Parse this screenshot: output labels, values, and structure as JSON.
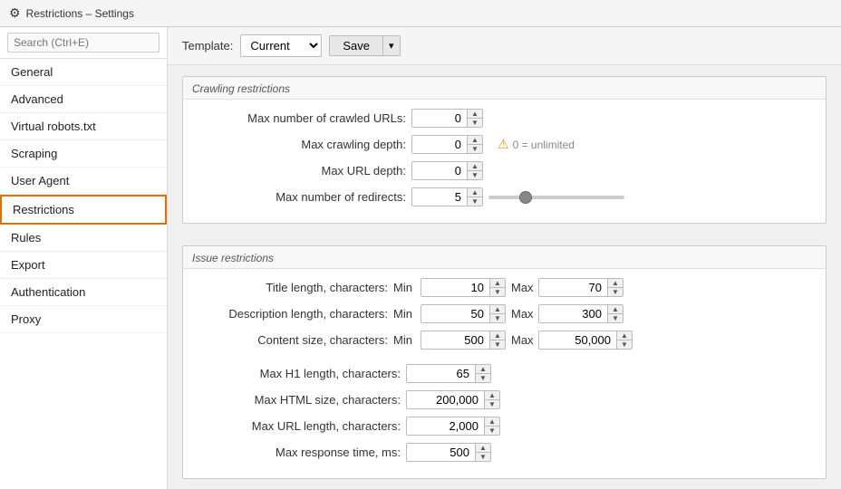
{
  "titleBar": {
    "icon": "⚙",
    "title": "Restrictions – Settings"
  },
  "toolbar": {
    "templateLabel": "Template:",
    "templateValue": "Current",
    "saveLabel": "Save",
    "arrowLabel": "▾"
  },
  "sidebar": {
    "searchPlaceholder": "Search (Ctrl+E)",
    "items": [
      {
        "id": "general",
        "label": "General",
        "active": false
      },
      {
        "id": "advanced",
        "label": "Advanced",
        "active": false
      },
      {
        "id": "virtual-robots",
        "label": "Virtual robots.txt",
        "active": false
      },
      {
        "id": "scraping",
        "label": "Scraping",
        "active": false
      },
      {
        "id": "user-agent",
        "label": "User Agent",
        "active": false
      },
      {
        "id": "restrictions",
        "label": "Restrictions",
        "active": true
      },
      {
        "id": "rules",
        "label": "Rules",
        "active": false
      },
      {
        "id": "export",
        "label": "Export",
        "active": false
      },
      {
        "id": "authentication",
        "label": "Authentication",
        "active": false
      },
      {
        "id": "proxy",
        "label": "Proxy",
        "active": false
      }
    ]
  },
  "crawlingSection": {
    "title": "Crawling restrictions",
    "fields": [
      {
        "id": "max-crawled-urls",
        "label": "Max number of crawled URLs:",
        "labelWidth": "225",
        "value": "0"
      },
      {
        "id": "max-crawling-depth",
        "label": "Max crawling depth:",
        "labelWidth": "225",
        "value": "0"
      },
      {
        "id": "max-url-depth",
        "label": "Max URL depth:",
        "labelWidth": "225",
        "value": "0"
      },
      {
        "id": "max-redirects",
        "label": "Max number of redirects:",
        "labelWidth": "225",
        "value": "5"
      }
    ],
    "warningText": "0 = unlimited",
    "sliderValue": "5",
    "sliderMin": "0",
    "sliderMax": "20"
  },
  "issueSection": {
    "title": "Issue restrictions",
    "rangeFields": [
      {
        "id": "title-length",
        "label": "Title length, characters:",
        "minVal": "10",
        "maxVal": "70"
      },
      {
        "id": "desc-length",
        "label": "Description length, characters:",
        "minVal": "50",
        "maxVal": "300"
      },
      {
        "id": "content-size",
        "label": "Content size, characters:",
        "minVal": "500",
        "maxVal": "50,000"
      }
    ],
    "singleFields": [
      {
        "id": "max-h1",
        "label": "Max H1 length, characters:",
        "value": "65"
      },
      {
        "id": "max-html",
        "label": "Max HTML size, characters:",
        "value": "200,000"
      },
      {
        "id": "max-url-length",
        "label": "Max URL length, characters:",
        "value": "2,000"
      },
      {
        "id": "max-response",
        "label": "Max response time, ms:",
        "value": "500"
      }
    ]
  }
}
